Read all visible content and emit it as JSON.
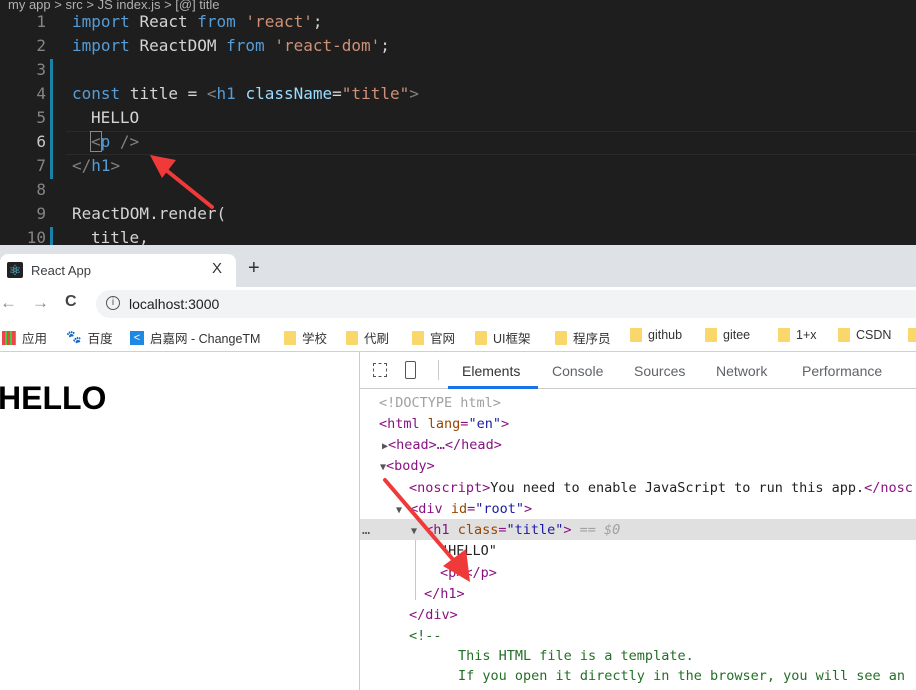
{
  "editor": {
    "breadcrumb": "my app > src > JS index.js > [@] title",
    "line_numbers": [
      "1",
      "2",
      "3",
      "4",
      "5",
      "6",
      "7",
      "8",
      "9",
      "10"
    ],
    "lines": {
      "l1": {
        "kw1": "import",
        "id": "React",
        "kw2": "from",
        "str": "'react'",
        "end": ";"
      },
      "l2": {
        "kw1": "import",
        "id": "ReactDOM",
        "kw2": "from",
        "str": "'react-dom'",
        "end": ";"
      },
      "l4": {
        "kw": "const",
        "id": "title",
        "eq": "=",
        "open": "<",
        "tag": "h1",
        "attr": "className",
        "eqs": "=",
        "val": "\"title\"",
        "close": ">"
      },
      "l5": "HELLO",
      "l6": {
        "open": "<",
        "tag": "p",
        "close": " />"
      },
      "l7": {
        "open": "</",
        "tag": "h1",
        "close": ">"
      },
      "l9": "ReactDOM.render(",
      "l10": "title,"
    }
  },
  "browser": {
    "tab_title": "React App",
    "tab_close": "X",
    "new_tab": "+",
    "back": "←",
    "forward": "→",
    "reload": "C",
    "info": "i",
    "url": "localhost:3000",
    "bookmarks": [
      "应用",
      "百度",
      "启嘉网 - ChangeTM",
      "学校",
      "代刷",
      "官网",
      "UI框架",
      "程序员",
      "github",
      "gitee",
      "1+x",
      "CSDN"
    ],
    "page_heading": "HELLO"
  },
  "devtools": {
    "tabs": [
      "Elements",
      "Console",
      "Sources",
      "Network",
      "Performance"
    ],
    "active_tab": "Elements",
    "dom": {
      "doctype": "<!DOCTYPE html>",
      "html_open": "<html",
      "html_attr": "lang",
      "html_val": "\"en\"",
      "head": "<head>…</head>",
      "body": "<body>",
      "noscript_open": "<noscript>",
      "noscript_text": "You need to enable JavaScript to run this app.",
      "noscript_close": "</nosc",
      "div_open": "<div",
      "div_attr": "id",
      "div_val": "\"root\"",
      "h1_open": "<h1",
      "h1_attr": "class",
      "h1_val": "\"title\"",
      "h1_marker": "== $0",
      "text_node": "\"HELLO\"",
      "p_open": "<p>",
      "p_close": "</p>",
      "h1_close": "</h1>",
      "div_close": "</div>",
      "comment_open": "<!--",
      "comment_1": "This HTML file is a template.",
      "comment_2": "If you open it directly in the browser, you will see an",
      "more": "…"
    }
  },
  "colors": {
    "annotation_arrow": "#f03a3a",
    "accent": "#1a73e8"
  }
}
